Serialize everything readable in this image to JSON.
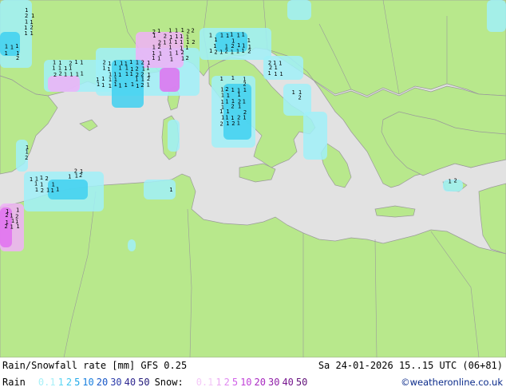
{
  "map": {
    "colors": {
      "sea": "#e2e2e2",
      "land": "#b8e88c",
      "border": "#9a9a9a",
      "rain_light": "#a0f0f8",
      "rain_mid": "#40d0f0",
      "snow_light": "#f0b0f8",
      "snow_mid": "#e070f0",
      "marker": "#000000"
    }
  },
  "footer": {
    "title": "Rain/Snowfall rate [mm] GFS 0.25",
    "datetime": "Sa 24-01-2026 15..15 UTC (06+81)",
    "credit": "©weatheronline.co.uk",
    "rain_label": "Rain",
    "snow_label": "Snow:",
    "rain_scale": [
      {
        "text": "0.1",
        "color": "#a8f0f8"
      },
      {
        "text": "1",
        "color": "#60d8f4"
      },
      {
        "text": "2",
        "color": "#40c8f0"
      },
      {
        "text": "5",
        "color": "#20a8e8"
      },
      {
        "text": "10",
        "color": "#1880e0"
      },
      {
        "text": "20",
        "color": "#1858c8"
      },
      {
        "text": "30",
        "color": "#2838a8"
      },
      {
        "text": "40",
        "color": "#302890"
      },
      {
        "text": "50",
        "color": "#201878"
      }
    ],
    "snow_scale": [
      {
        "text": "0.1",
        "color": "#f4c8f8"
      },
      {
        "text": "1",
        "color": "#eca8f4"
      },
      {
        "text": "2",
        "color": "#e088f0"
      },
      {
        "text": "5",
        "color": "#d060e8"
      },
      {
        "text": "10",
        "color": "#c040d8"
      },
      {
        "text": "20",
        "color": "#a828c0"
      },
      {
        "text": "30",
        "color": "#9020a8"
      },
      {
        "text": "40",
        "color": "#781890"
      },
      {
        "text": "50",
        "color": "#601078"
      }
    ]
  }
}
